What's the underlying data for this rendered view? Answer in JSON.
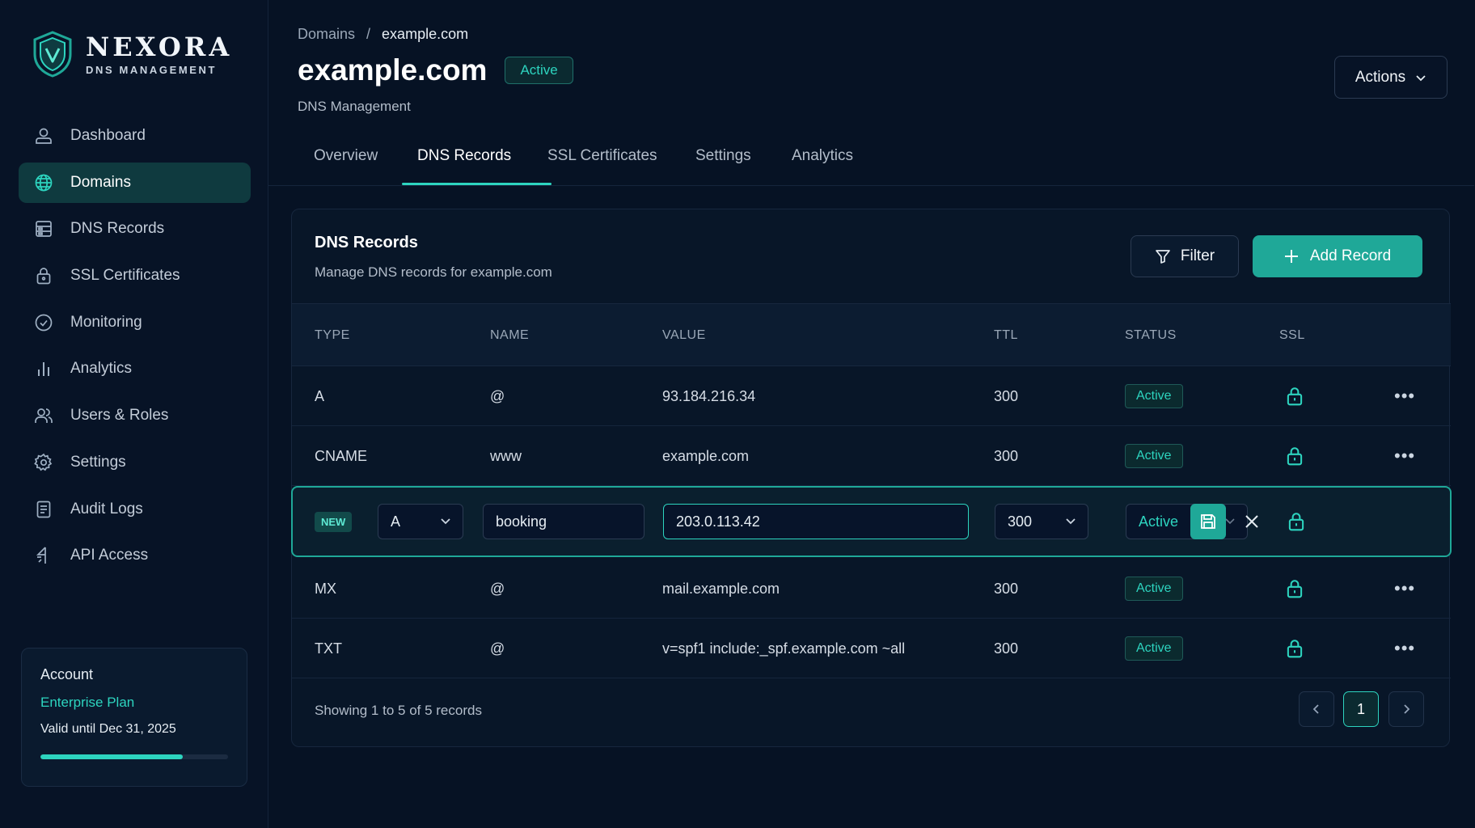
{
  "brand": {
    "name": "NEXORA",
    "subtitle": "DNS MANAGEMENT"
  },
  "sidebar": {
    "items": [
      {
        "label": "Dashboard",
        "icon": "dashboard-icon",
        "active": false
      },
      {
        "label": "Domains",
        "icon": "globe-icon",
        "active": true
      },
      {
        "label": "DNS Records",
        "icon": "records-icon",
        "active": false
      },
      {
        "label": "SSL Certificates",
        "icon": "lock-icon",
        "active": false
      },
      {
        "label": "Monitoring",
        "icon": "monitoring-icon",
        "active": false
      },
      {
        "label": "Analytics",
        "icon": "analytics-icon",
        "active": false
      },
      {
        "label": "Users & Roles",
        "icon": "users-icon",
        "active": false
      },
      {
        "label": "Settings",
        "icon": "gear-icon",
        "active": false
      },
      {
        "label": "Audit Logs",
        "icon": "document-icon",
        "active": false
      },
      {
        "label": "API Access",
        "icon": "api-icon",
        "active": false
      }
    ],
    "account": {
      "title": "Account",
      "plan": "Enterprise Plan",
      "valid": "Valid until Dec 31, 2025",
      "progress": 0.76
    }
  },
  "header": {
    "breadcrumb": {
      "root": "Domains",
      "separator": "/",
      "current": "example.com"
    },
    "title": "example.com",
    "status": "Active",
    "subtitle": "DNS Management",
    "actions_label": "Actions"
  },
  "tabs": [
    {
      "label": "Overview",
      "active": false
    },
    {
      "label": "DNS Records",
      "active": true
    },
    {
      "label": "SSL Certificates",
      "active": false
    },
    {
      "label": "Settings",
      "active": false
    },
    {
      "label": "Analytics",
      "active": false
    }
  ],
  "records_card": {
    "title": "DNS Records",
    "subtitle": "Manage DNS records for example.com",
    "filter_label": "Filter",
    "add_label": "Add Record",
    "columns": [
      "TYPE",
      "NAME",
      "VALUE",
      "TTL",
      "STATUS",
      "SSL"
    ],
    "rows": [
      {
        "type": "A",
        "name": "@",
        "value": "93.184.216.34",
        "ttl": "300",
        "status": "Active"
      },
      {
        "type": "CNAME",
        "name": "www",
        "value": "example.com",
        "ttl": "300",
        "status": "Active"
      },
      {
        "type": "MX",
        "name": "@",
        "value": "mail.example.com",
        "ttl": "300",
        "status": "Active"
      },
      {
        "type": "TXT",
        "name": "@",
        "value": "v=spf1 include:_spf.example.com ~all",
        "ttl": "300",
        "status": "Active"
      }
    ],
    "new_row": {
      "badge": "NEW",
      "type": "A",
      "name": "booking",
      "value": "203.0.113.42",
      "ttl": "300",
      "status": "Active"
    },
    "footer": "Showing 1 to 5 of 5 records",
    "page": "1"
  },
  "colors": {
    "accent": "#2dd4bf",
    "background": "#061224",
    "button": "#1fa898"
  }
}
